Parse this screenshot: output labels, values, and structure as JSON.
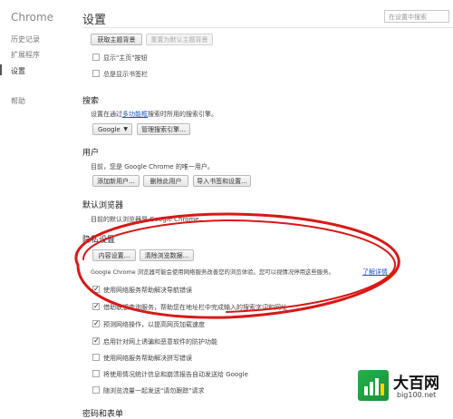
{
  "sidebar": {
    "title": "Chrome",
    "items": [
      {
        "label": "历史记录"
      },
      {
        "label": "扩展程序"
      },
      {
        "label": "设置"
      },
      {
        "label": "帮助"
      }
    ]
  },
  "header": {
    "title": "设置",
    "search_placeholder": "在设置中搜索"
  },
  "appearance": {
    "get_themes": "获取主题背景",
    "reset_theme": "重置为默认主题背景",
    "show_home": "显示\"主页\"按钮",
    "show_bookmarks": "总是显示书签栏"
  },
  "search": {
    "heading": "搜索",
    "desc_prefix": "设置在通过",
    "desc_link": "多功能框",
    "desc_suffix": "搜索时所用的搜索引擎。",
    "engine": "Google",
    "manage": "管理搜索引擎..."
  },
  "users": {
    "heading": "用户",
    "desc": "目前，您是 Google Chrome 的唯一用户。",
    "add": "添加新用户...",
    "delete": "删除此用户",
    "import": "导入书签和设置..."
  },
  "default_browser": {
    "heading": "默认浏览器",
    "desc": "目前的默认浏览器是 Google Chrome。"
  },
  "privacy": {
    "heading": "隐私设置",
    "content_settings": "内容设置...",
    "clear_data": "清除浏览数据...",
    "desc": "Google Chrome 浏览器可能会使用网络服务改善您的浏览体验。您可以视情况停用这些服务。",
    "learn_more": "了解详情",
    "options": [
      {
        "label": "使用网络服务帮助解决导航错误",
        "checked": true
      },
      {
        "label": "借助联想查询服务，帮助您在地址栏中完成输入的搜索字词和网址",
        "checked": true
      },
      {
        "label": "预测网络操作，以提高网页加载速度",
        "checked": true
      },
      {
        "label": "启用针对网上诱骗和恶意软件的防护功能",
        "checked": true
      },
      {
        "label": "使用网络服务帮助解决拼写错误",
        "checked": false
      },
      {
        "label": "将使用情况统计信息和崩溃报告自动发送给 Google",
        "checked": false
      },
      {
        "label": "随浏览流量一起发送\"请勿跟踪\"请求",
        "checked": false
      }
    ]
  },
  "passwords": {
    "heading": "密码和表单"
  },
  "watermark": {
    "name": "大百网",
    "url": "big100.net"
  },
  "colors": {
    "annotation": "#d81818",
    "link": "#1a55c4"
  }
}
